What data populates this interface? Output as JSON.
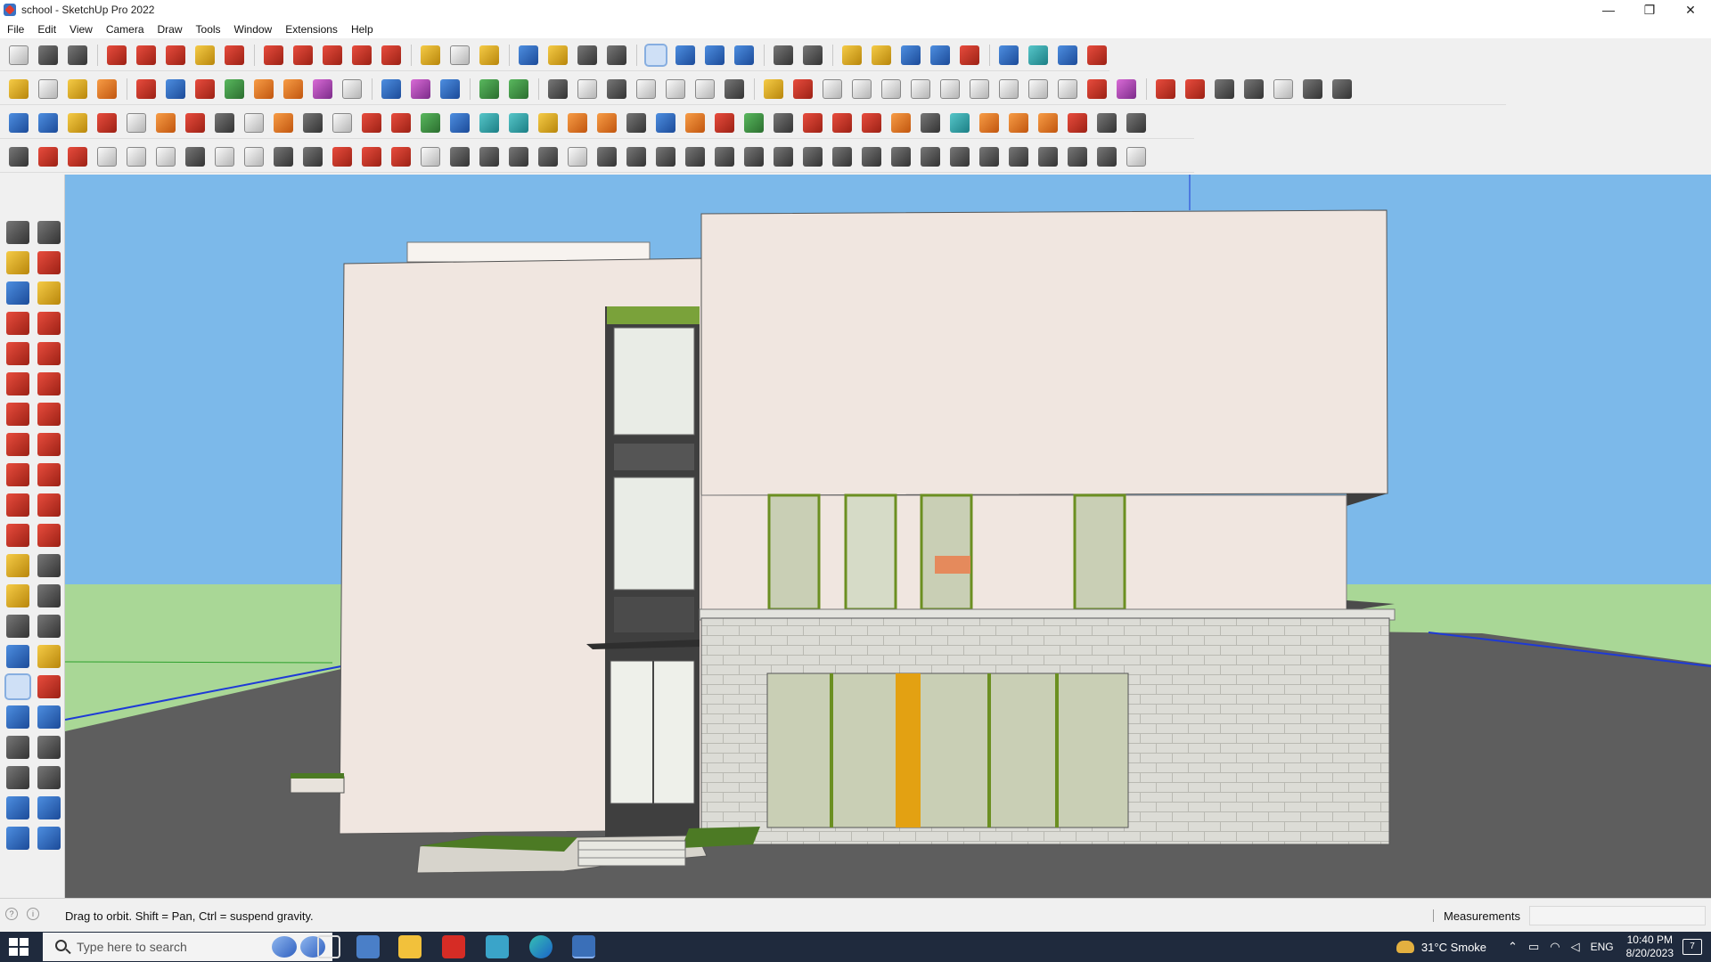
{
  "window": {
    "title": "school - SketchUp Pro 2022",
    "minimize_glyph": "—",
    "restore_glyph": "❐",
    "close_glyph": "✕"
  },
  "menu": [
    "File",
    "Edit",
    "View",
    "Camera",
    "Draw",
    "Tools",
    "Window",
    "Extensions",
    "Help"
  ],
  "toolbars": {
    "row1": [
      "t-w",
      "t-k",
      "t-k",
      "sep",
      "t-r",
      "t-r",
      "t-r",
      "t-y",
      "t-r",
      "sep",
      "t-r",
      "t-r",
      "t-r",
      "t-r",
      "t-r",
      "sep",
      "t-y",
      "t-w",
      "t-y",
      "sep",
      "t-b",
      "t-y",
      "t-k",
      "t-k",
      "sep",
      "t-b",
      "t-b",
      "t-b",
      "t-b",
      "sep",
      "t-k",
      "t-k",
      "sep",
      "t-y",
      "t-y",
      "t-b",
      "t-b",
      "t-r",
      "sep",
      "t-b",
      "t-t",
      "t-b",
      "t-r",
      "t-r"
    ],
    "row2": [
      "t-y",
      "t-w",
      "t-y",
      "t-o",
      "sep",
      "t-r",
      "t-b",
      "t-r",
      "t-g",
      "t-o",
      "t-o",
      "t-p",
      "t-w",
      "sep",
      "t-b",
      "t-p",
      "t-b",
      "sep",
      "t-g",
      "t-g",
      "sep",
      "t-k",
      "t-w",
      "t-k",
      "t-w",
      "t-w",
      "t-w",
      "t-k",
      "sep",
      "t-y",
      "t-r",
      "t-w",
      "t-w",
      "t-w",
      "t-w",
      "t-w",
      "t-w",
      "t-w",
      "t-w",
      "t-w",
      "t-r",
      "t-p",
      "sep",
      "t-r",
      "t-r",
      "t-k",
      "t-k",
      "t-w",
      "t-k",
      "t-k"
    ],
    "row3": [
      "t-b",
      "t-b",
      "t-y",
      "t-r",
      "t-w",
      "t-o",
      "t-r",
      "t-k",
      "t-w",
      "t-o",
      "t-k",
      "t-w",
      "t-r",
      "t-r",
      "t-g",
      "t-b",
      "t-t",
      "t-t",
      "t-y",
      "t-o",
      "t-o",
      "t-k",
      "t-b",
      "t-o",
      "t-r",
      "t-g",
      "t-k",
      "t-r",
      "t-r",
      "t-r",
      "t-o",
      "t-k",
      "t-t",
      "t-o",
      "t-o",
      "t-o",
      "t-r",
      "t-k",
      "t-k"
    ],
    "row4": [
      "t-k",
      "t-r",
      "t-r",
      "t-w",
      "t-w",
      "t-w",
      "t-k",
      "t-w",
      "t-w",
      "t-k",
      "t-k",
      "t-r",
      "t-r",
      "t-r",
      "t-w",
      "t-k",
      "t-k",
      "t-k",
      "t-k",
      "t-w",
      "t-k",
      "t-k",
      "t-k",
      "t-k",
      "t-k",
      "t-k",
      "t-k",
      "t-k",
      "t-k",
      "t-k",
      "t-k",
      "t-k",
      "t-k",
      "t-k",
      "t-k",
      "t-k",
      "t-k",
      "t-k",
      "t-w"
    ]
  },
  "left_tools": [
    "t-k",
    "t-k",
    "t-y",
    "t-r",
    "t-b",
    "t-y",
    "t-r",
    "t-r",
    "t-r",
    "t-r",
    "t-r",
    "t-r",
    "t-r",
    "t-r",
    "t-r",
    "t-r",
    "t-r",
    "t-r",
    "t-r",
    "t-r",
    "t-r",
    "t-r",
    "t-y",
    "t-k",
    "t-y",
    "t-k",
    "t-k",
    "t-k",
    "t-b",
    "t-y",
    "t-b",
    "t-r",
    "t-b",
    "t-b",
    "t-k",
    "t-k",
    "t-k",
    "t-k",
    "t-b",
    "t-b",
    "t-b",
    "t-b"
  ],
  "scene": {
    "model": "school",
    "colors": {
      "sky": "#7cb9ea",
      "ground": "#5e5e5e",
      "grass": "#a9d796",
      "plaster": "#f0e6e0",
      "stone": "#dcdcd6",
      "glass": "#c9cfb5",
      "accent": "#e3a112",
      "frame": "#6b8f21"
    }
  },
  "status": {
    "hint": "Drag to orbit. Shift = Pan, Ctrl = suspend gravity.",
    "measurements_label": "Measurements",
    "measurements_value": ""
  },
  "taskbar": {
    "search_placeholder": "Type here to search",
    "weather": "31°C  Smoke",
    "language": "ENG",
    "time": "10:40 PM",
    "date": "8/20/2023",
    "notifications": "7"
  }
}
